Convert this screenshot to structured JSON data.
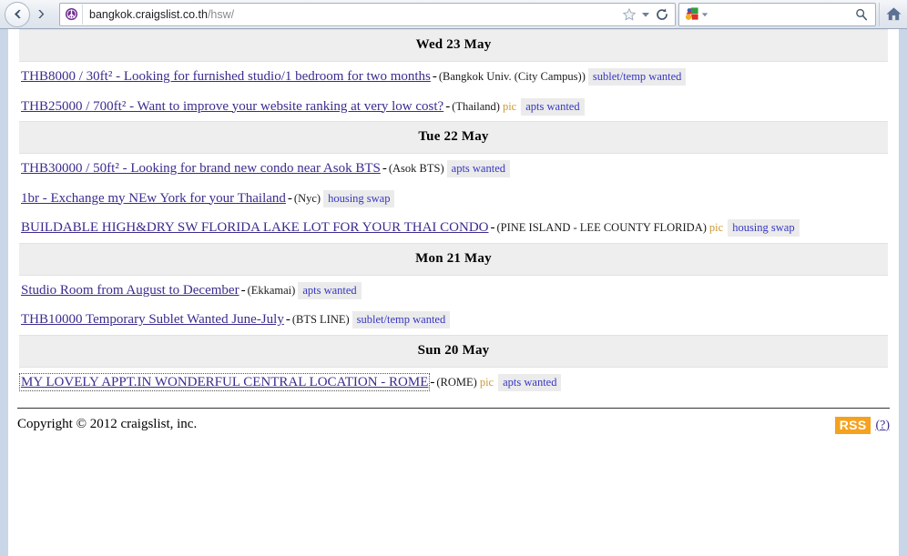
{
  "browser": {
    "back_label": "←",
    "forward_label": "→",
    "favicon_name": "craigslist-peace-favicon",
    "url_host": "bangkok.craigslist.co.th",
    "url_path": "/hsw/",
    "url_full": "bangkok.craigslist.co.th/hsw/",
    "bookmark_icon": "star-icon",
    "dropdown_icon": "chevron-down-icon",
    "reload_icon": "reload-icon",
    "search_engine_icon": "google-icon",
    "search_value": "",
    "search_placeholder": "",
    "search_go_icon": "magnifier-icon",
    "home_icon": "home-icon"
  },
  "page": {
    "sections": [
      {
        "date": "Wed 23 May",
        "listings": [
          {
            "title": "THB8000 / 30ft² - Looking for furnished studio/1 bedroom for two months",
            "sep": "-",
            "hood": "(Bangkok Univ. (City Campus))",
            "pic": "",
            "category": "sublet/temp wanted",
            "focused": false
          },
          {
            "title": "THB25000 / 700ft² - Want to improve your website ranking at very low cost?",
            "sep": "-",
            "hood": "(Thailand)",
            "pic": "pic",
            "category": "apts wanted",
            "focused": false
          }
        ]
      },
      {
        "date": "Tue 22 May",
        "listings": [
          {
            "title": "THB30000 / 50ft² - Looking for brand new condo near Asok BTS",
            "sep": "-",
            "hood": "(Asok BTS)",
            "pic": "",
            "category": "apts wanted",
            "focused": false
          },
          {
            "title": "1br - Exchange my NEw York for your Thailand",
            "sep": "-",
            "hood": "(Nyc)",
            "pic": "",
            "category": "housing swap",
            "focused": false
          },
          {
            "title": "BUILDABLE HIGH&DRY SW FLORIDA LAKE LOT FOR YOUR THAI CONDO",
            "sep": "-",
            "hood": "(PINE ISLAND - LEE COUNTY FLORIDA)",
            "pic": "pic",
            "category": "housing swap",
            "focused": false
          }
        ]
      },
      {
        "date": "Mon 21 May",
        "listings": [
          {
            "title": "Studio Room from August to December",
            "sep": "-",
            "hood": "(Ekkamai)",
            "pic": "",
            "category": "apts wanted",
            "focused": false
          },
          {
            "title": "THB10000 Temporary Sublet Wanted June-July",
            "sep": "-",
            "hood": "(BTS LINE)",
            "pic": "",
            "category": "sublet/temp wanted",
            "focused": false
          }
        ]
      },
      {
        "date": "Sun 20 May",
        "listings": [
          {
            "title": "MY LOVELY APPT.IN WONDERFUL CENTRAL LOCATION - ROME",
            "sep": "-",
            "hood": "(ROME)",
            "pic": "pic",
            "category": "apts wanted",
            "focused": true
          }
        ]
      }
    ],
    "footer": {
      "copyright": "Copyright © 2012 craigslist, inc.",
      "rss_label": "RSS",
      "rss_help_label": "(?)"
    }
  },
  "colors": {
    "link": "#3d2b8f",
    "tag_text": "#3737c4",
    "tag_bg": "#ebebeb",
    "pic": "#cc9a33",
    "date_bar_bg": "#eeeeee",
    "rss_bg": "#f5a21e",
    "chrome_border": "#c9d6e8"
  }
}
